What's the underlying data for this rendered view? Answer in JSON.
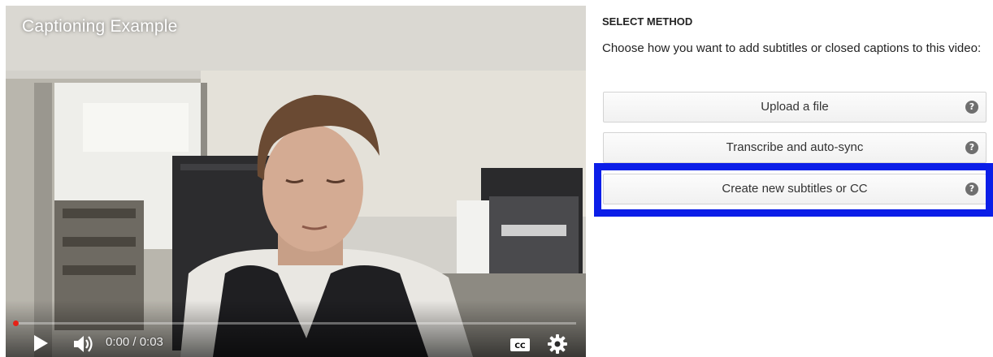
{
  "video": {
    "title": "Captioning Example",
    "time_display": "0:00 / 0:03",
    "progress": 0.0
  },
  "controls": {
    "play_icon": "play-icon",
    "volume_icon": "volume-icon",
    "cc_icon": "closed-captions-icon",
    "cc_label": "CC",
    "settings_icon": "gear-icon"
  },
  "panel": {
    "heading": "SELECT METHOD",
    "description": "Choose how you want to add subtitles or closed captions to this video:",
    "options": [
      {
        "label": "Upload a file",
        "help": "?"
      },
      {
        "label": "Transcribe and auto-sync",
        "help": "?"
      },
      {
        "label": "Create new subtitles or CC",
        "help": "?",
        "highlighted": true
      }
    ]
  },
  "colors": {
    "highlight": "#0b1ee8",
    "progress_played": "#ff0000",
    "button_border": "#d3d3d3"
  }
}
